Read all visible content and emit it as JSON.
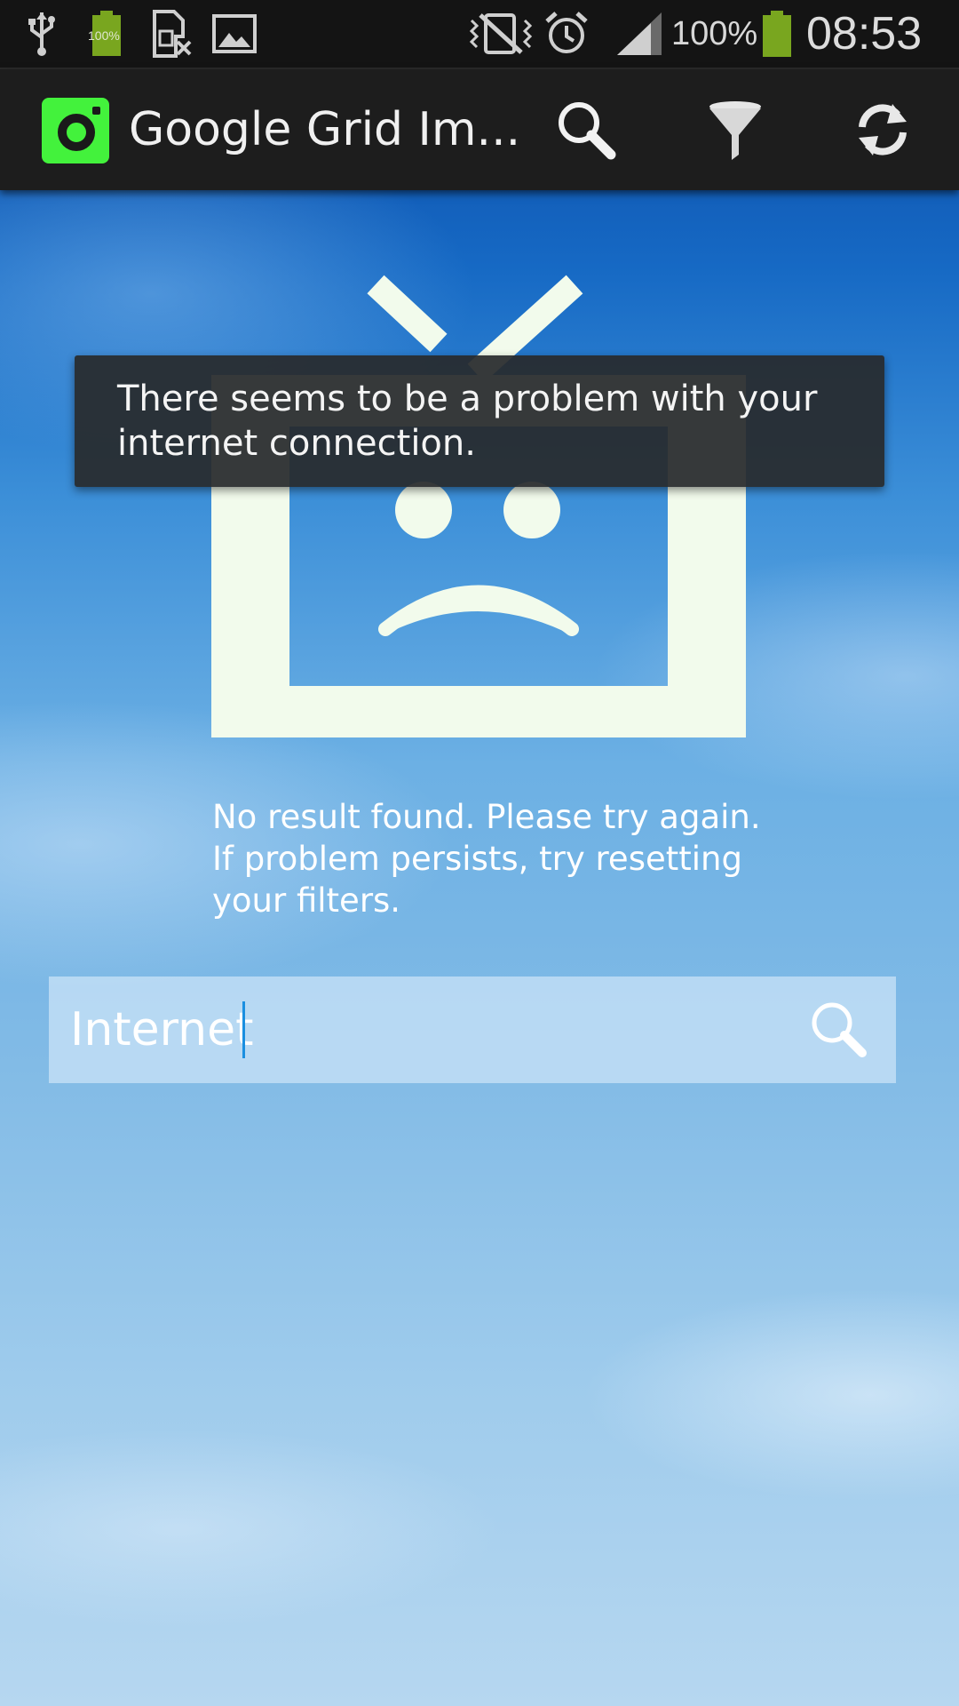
{
  "status_bar": {
    "battery_percent": "100%",
    "mini_battery_label": "100%",
    "time": "08:53",
    "battery_color": "#79a61f"
  },
  "action_bar": {
    "app_title": "Google Grid Im...",
    "app_icon_color": "#43f23c",
    "icons": [
      "search-icon",
      "filter-icon",
      "refresh-icon"
    ]
  },
  "toast": {
    "line1": "There seems to be a problem with your",
    "line2": "internet connection."
  },
  "error": {
    "line1": "No result found. Please try again.",
    "line2": "If problem persists, try resetting",
    "line3": "your filters."
  },
  "search": {
    "value": "Internet"
  }
}
